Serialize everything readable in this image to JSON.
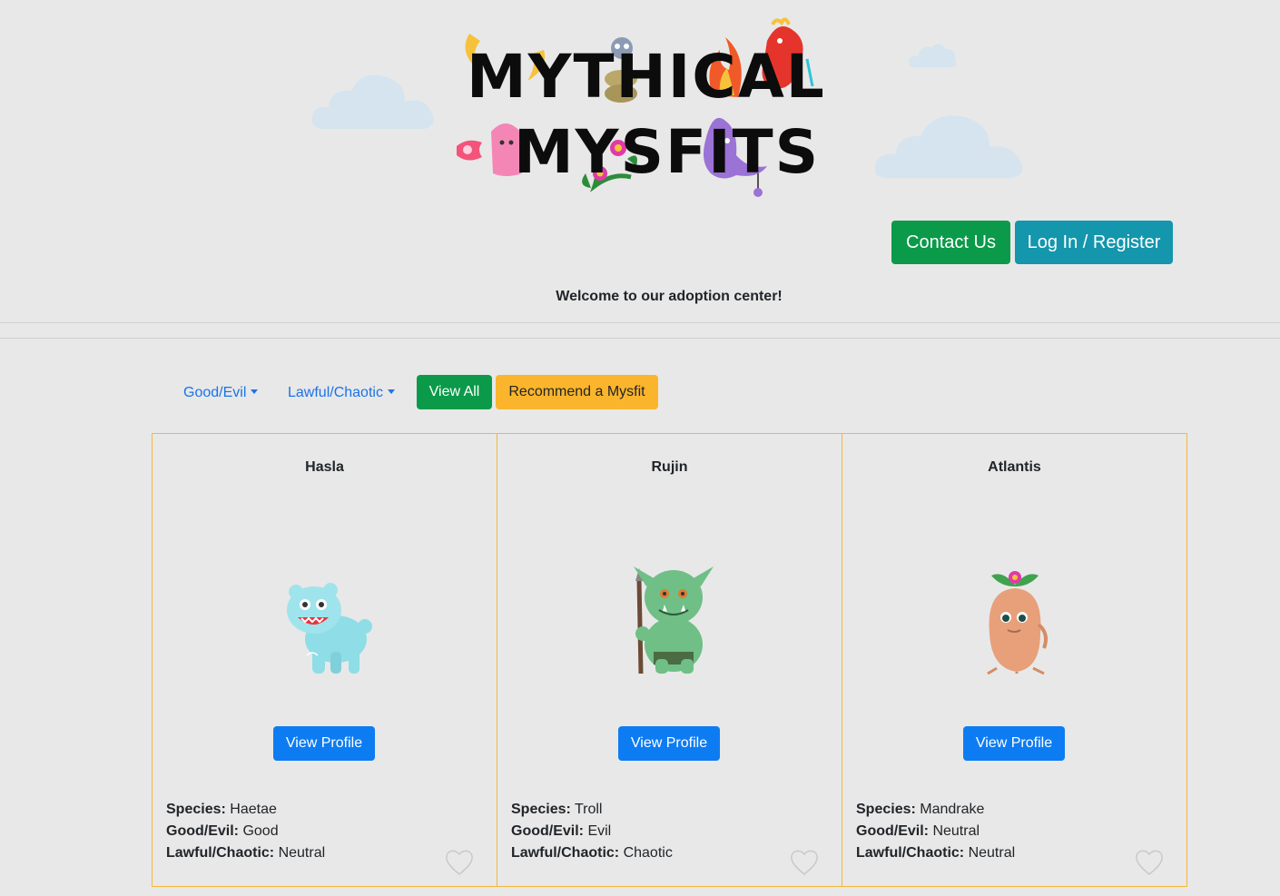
{
  "brand": {
    "logo_line1": "MYTHICAL",
    "logo_line2": "MYSFITS"
  },
  "header": {
    "contact_label": "Contact Us",
    "login_label": "Log In / Register",
    "welcome_text": "Welcome to our adoption center!"
  },
  "filters": {
    "good_evil_label": "Good/Evil",
    "lawful_chaotic_label": "Lawful/Chaotic",
    "view_all_label": "View All",
    "recommend_label": "Recommend a Mysfit"
  },
  "labels": {
    "species": "Species:",
    "good_evil": "Good/Evil:",
    "lawful_chaotic": "Lawful/Chaotic:",
    "view_profile": "View Profile"
  },
  "mysfits": [
    {
      "name": "Hasla",
      "species": "Haetae",
      "good_evil": "Good",
      "lawful_chaotic": "Neutral",
      "icon": "haetae-icon"
    },
    {
      "name": "Rujin",
      "species": "Troll",
      "good_evil": "Evil",
      "lawful_chaotic": "Chaotic",
      "icon": "troll-icon"
    },
    {
      "name": "Atlantis",
      "species": "Mandrake",
      "good_evil": "Neutral",
      "lawful_chaotic": "Neutral",
      "icon": "mandrake-icon"
    }
  ],
  "colors": {
    "background": "#e8e8e8",
    "success": "#0a9a49",
    "info": "#1496ad",
    "primary": "#0d7cf2",
    "warning": "#fbb52c",
    "card_border": "#f6b63a"
  }
}
